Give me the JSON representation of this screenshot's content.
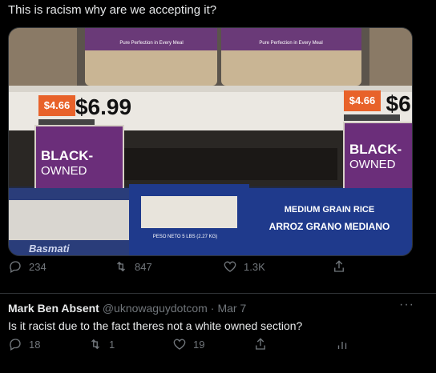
{
  "tweet": {
    "text": "This is racism why are we accepting it?",
    "stats": {
      "replies": "234",
      "retweets": "847",
      "likes": "1.3K"
    }
  },
  "photo": {
    "price_small_left": "$4.66",
    "price_big_left": "$6.99",
    "price_small_right": "$4.66",
    "price_big_right": "$6.",
    "sign_left": [
      "BLACK-",
      "OWNED"
    ],
    "sign_right": [
      "BLACK-",
      "OWNED"
    ],
    "rice_label": "Pure Perfection in Every Meal",
    "bag_left": "Basmati",
    "bag_center": "PESO NETO 5 LBS (2.27 KG)",
    "bag_right_top": "MEDIUM GRAIN RICE",
    "bag_right_bottom": "ARROZ GRANO MEDIANO"
  },
  "reply": {
    "name": "Mark Ben Absent",
    "handle": "@uknowaguydotcom",
    "sep": "·",
    "date": "Mar 7",
    "text": "Is it racist due to the fact theres not a white owned section?",
    "stats": {
      "replies": "18",
      "retweets": "1",
      "likes": "19"
    }
  },
  "colors": {
    "sign_purple": "#6b2e7a",
    "price_orange": "#e8622a",
    "accent_muted": "#71767b"
  }
}
